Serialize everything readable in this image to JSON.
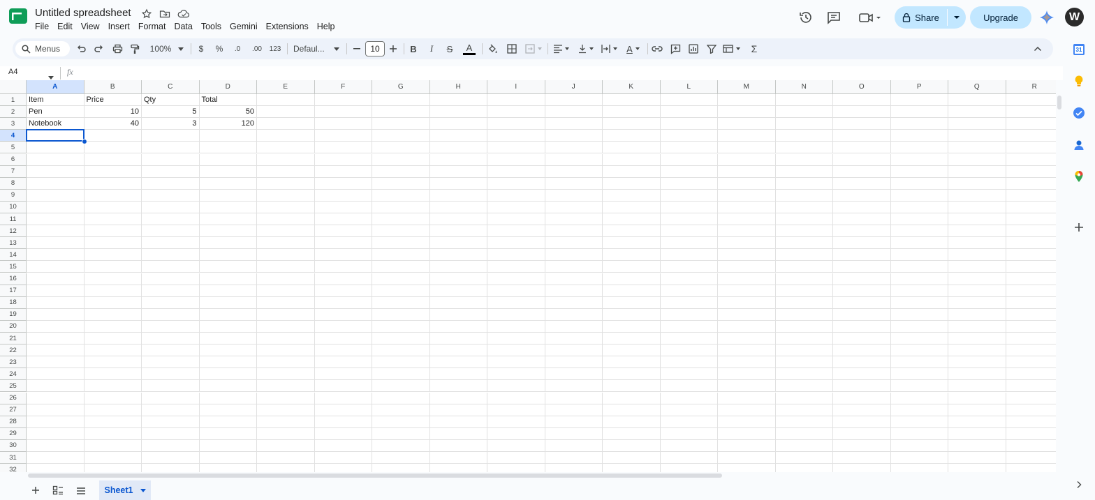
{
  "app": {
    "doc_title": "Untitled spreadsheet",
    "menu": [
      "File",
      "Edit",
      "View",
      "Insert",
      "Format",
      "Data",
      "Tools",
      "Gemini",
      "Extensions",
      "Help"
    ],
    "share_label": "Share",
    "upgrade_label": "Upgrade",
    "avatar_letter": "W",
    "brand_color": "#0f9d58",
    "accent_color": "#0b57d0"
  },
  "toolbar": {
    "search_label": "Menus",
    "zoom": "100%",
    "currency": "$",
    "percent": "%",
    "decimal_decrease": ".0",
    "decimal_increase": ".00",
    "number_format": "123",
    "font": "Defaul...",
    "font_size": "10",
    "bold": "B",
    "italic": "I",
    "strike": "S",
    "text_color_glyph": "A",
    "rotate_glyph": "A",
    "sum": "Σ"
  },
  "formula_bar": {
    "name_box": "A4",
    "fx": "fx",
    "value": ""
  },
  "grid": {
    "columns": [
      "A",
      "B",
      "C",
      "D",
      "E",
      "F",
      "G",
      "H",
      "I",
      "J",
      "K",
      "L",
      "M",
      "N",
      "O",
      "P",
      "Q",
      "R"
    ],
    "rows": [
      "1",
      "2",
      "3",
      "4",
      "5",
      "6",
      "7",
      "8",
      "9",
      "10",
      "11",
      "12",
      "13",
      "14",
      "15",
      "16",
      "17",
      "18",
      "19",
      "20",
      "21",
      "22",
      "23",
      "24",
      "25",
      "26",
      "27",
      "28",
      "29",
      "30",
      "31",
      "32"
    ],
    "selected_cell": "A4",
    "cells": [
      [
        "Item",
        "Price",
        "Qty",
        "Total"
      ],
      [
        "Pen",
        "10",
        "5",
        "50"
      ],
      [
        "Notebook",
        "40",
        "3",
        "120"
      ]
    ]
  },
  "sheets": {
    "active": "Sheet1"
  },
  "icons": {
    "header": [
      "star-icon",
      "move-to-folder-icon",
      "cloud-saved-icon",
      "version-history-icon",
      "comments-icon",
      "meet-icon",
      "lock-icon",
      "gemini-icon"
    ],
    "side_panel": [
      "calendar-icon",
      "keep-icon",
      "tasks-icon",
      "contacts-icon",
      "maps-icon",
      "add-icon"
    ],
    "calendar_day": "31"
  }
}
